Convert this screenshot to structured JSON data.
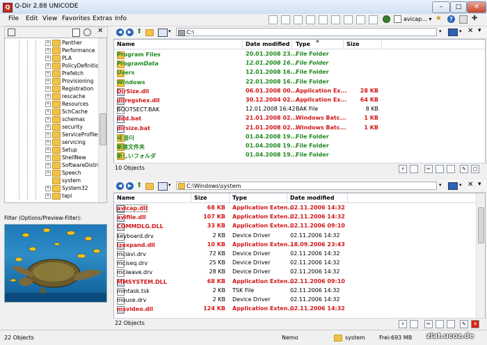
{
  "window": {
    "title": "Q-Dir 2.88  UNICODE",
    "app_icon": "Q"
  },
  "menu": [
    "File",
    "Edit",
    "View",
    "Favorites",
    "Extras",
    "Info"
  ],
  "toolbar_right": {
    "file_label": "avicap...",
    "help": "?"
  },
  "tree": {
    "items": [
      "Panther",
      "Performance",
      "PLA",
      "PolicyDefinitior",
      "Prefetch",
      "Provisioning",
      "Registration",
      "rescache",
      "Resources",
      "SchCache",
      "schemas",
      "security",
      "ServiceProfiles",
      "servicing",
      "Setup",
      "ShellNew",
      "SoftwareDistrib",
      "Speech",
      "system",
      "System32",
      "tapi"
    ],
    "expandable": [
      true,
      true,
      true,
      true,
      true,
      true,
      true,
      true,
      true,
      true,
      true,
      true,
      true,
      true,
      true,
      true,
      true,
      true,
      false,
      true,
      true
    ]
  },
  "preview": {
    "label": "Filter (Options/Preview-Filter):"
  },
  "pane1": {
    "path": "C:\\",
    "columns": [
      "Name",
      "Date modified",
      "Type",
      "Size"
    ],
    "rows": [
      {
        "name": "Program Files",
        "date": "20.01.2008 23...",
        "type": "File Folder",
        "size": "",
        "icon": "folder",
        "color": "green"
      },
      {
        "name": "ProgramData",
        "date": "12.01.2008 16...",
        "type": "File Folder",
        "size": "",
        "icon": "folder",
        "color": "green-italic"
      },
      {
        "name": "Users",
        "date": "12.01.2008 16...",
        "type": "File Folder",
        "size": "",
        "icon": "folder",
        "color": "green"
      },
      {
        "name": "Windows",
        "date": "22.01.2008 16...",
        "type": "File Folder",
        "size": "",
        "icon": "folder",
        "color": "green"
      },
      {
        "name": "DirSize.dll",
        "date": "06.01.2008 00...",
        "type": "Application Ex...",
        "size": "28 KB",
        "icon": "dll",
        "color": "red"
      },
      {
        "name": "dllregshex.dll",
        "date": "30.12.2004 02...",
        "type": "Application Ex...",
        "size": "64 KB",
        "icon": "dll",
        "color": "red"
      },
      {
        "name": "BOOTSECT.BAK",
        "date": "12.01.2008 16:42",
        "type": "BAK File",
        "size": "8 KB",
        "icon": "file",
        "color": "black"
      },
      {
        "name": "ddd.bat",
        "date": "21.01.2008 02...",
        "type": "Windows Batc...",
        "size": "1 KB",
        "icon": "bat",
        "color": "red"
      },
      {
        "name": "dirsize.bat",
        "date": "21.01.2008 02...",
        "type": "Windows Batc...",
        "size": "1 KB",
        "icon": "bat",
        "color": "red"
      },
      {
        "name": "새 폴더",
        "date": "01.04.2008 19...",
        "type": "File Folder",
        "size": "",
        "icon": "folder",
        "color": "green"
      },
      {
        "name": "新建文件夹",
        "date": "01.04.2008 19...",
        "type": "File Folder",
        "size": "",
        "icon": "folder",
        "color": "green"
      },
      {
        "name": "新しいフォルダ",
        "date": "01.04.2008 19...",
        "type": "File Folder",
        "size": "",
        "icon": "folder",
        "color": "green"
      }
    ],
    "status": "10 Objects"
  },
  "pane2": {
    "path": "C:\\Windows\\system",
    "columns": [
      "Name",
      "Size",
      "Type",
      "Date modified"
    ],
    "rows": [
      {
        "name": "avicap.dll",
        "size": "68 KB",
        "type": "Application Exten...",
        "date": "02.11.2006 14:32",
        "icon": "dll",
        "color": "red"
      },
      {
        "name": "avifile.dll",
        "size": "107 KB",
        "type": "Application Exten...",
        "date": "02.11.2006 14:32",
        "icon": "dll",
        "color": "red"
      },
      {
        "name": "COMMDLG.DLL",
        "size": "33 KB",
        "type": "Application Exten...",
        "date": "02.11.2006 09:10",
        "icon": "dll",
        "color": "red"
      },
      {
        "name": "keyboard.drv",
        "size": "2 KB",
        "type": "Device Driver",
        "date": "02.11.2006 14:32",
        "icon": "file",
        "color": "black"
      },
      {
        "name": "lzexpand.dll",
        "size": "10 KB",
        "type": "Application Exten...",
        "date": "18.09.2006 23:43",
        "icon": "dll",
        "color": "red"
      },
      {
        "name": "mciavi.drv",
        "size": "72 KB",
        "type": "Device Driver",
        "date": "02.11.2006 14:32",
        "icon": "file",
        "color": "black"
      },
      {
        "name": "mciseq.drv",
        "size": "25 KB",
        "type": "Device Driver",
        "date": "02.11.2006 14:32",
        "icon": "file",
        "color": "black"
      },
      {
        "name": "mciwave.drv",
        "size": "28 KB",
        "type": "Device Driver",
        "date": "02.11.2006 14:32",
        "icon": "file",
        "color": "black"
      },
      {
        "name": "MMSYSTEM.DLL",
        "size": "68 KB",
        "type": "Application Exten...",
        "date": "02.11.2006 09:10",
        "icon": "dll",
        "color": "red"
      },
      {
        "name": "mmtask.tsk",
        "size": "2 KB",
        "type": "TSK File",
        "date": "02.11.2006 14:32",
        "icon": "file",
        "color": "black"
      },
      {
        "name": "mouse.drv",
        "size": "2 KB",
        "type": "Device Driver",
        "date": "02.11.2006 14:32",
        "icon": "file",
        "color": "black"
      },
      {
        "name": "msvideo.dll",
        "size": "124 KB",
        "type": "Application Exten...",
        "date": "02.11.2006 14:32",
        "icon": "dll",
        "color": "red"
      }
    ],
    "status": "22 Objects"
  },
  "statusbar": {
    "left": "22 Objects",
    "user": "Nemo",
    "folder": "system",
    "free": "Frei:693 MB",
    "watermark": "zlat.ucoz.de"
  },
  "colors": {
    "green": "#1f8a1f",
    "red": "#d01818",
    "accent": "#2b64b7"
  }
}
